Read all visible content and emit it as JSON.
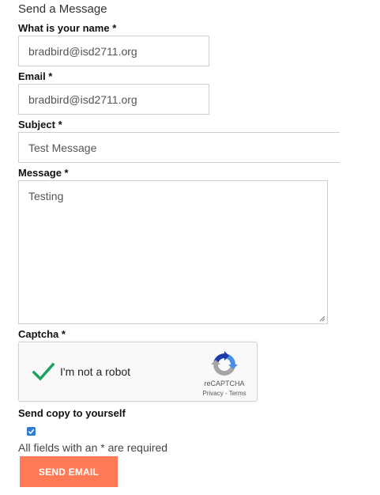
{
  "form": {
    "title": "Send a Message",
    "name_label": "What is your name *",
    "name_value": "bradbird@isd2711.org",
    "email_label": "Email *",
    "email_value": "bradbird@isd2711.org",
    "subject_label": "Subject *",
    "subject_value": "Test Message",
    "message_label": "Message *",
    "message_value": "Testing",
    "captcha_label": "Captcha *",
    "copy_label": "Send copy to yourself",
    "copy_checked": true,
    "required_note": "All fields with an * are required",
    "submit_label": "SEND EMAIL"
  },
  "captcha": {
    "text": "I'm not a robot",
    "brand": "reCAPTCHA",
    "links": "Privacy - Terms",
    "checked": true
  },
  "colors": {
    "accent_button": "#ff7a55",
    "checkbox": "#2f7bd9",
    "captcha_check": "#1aa260"
  }
}
